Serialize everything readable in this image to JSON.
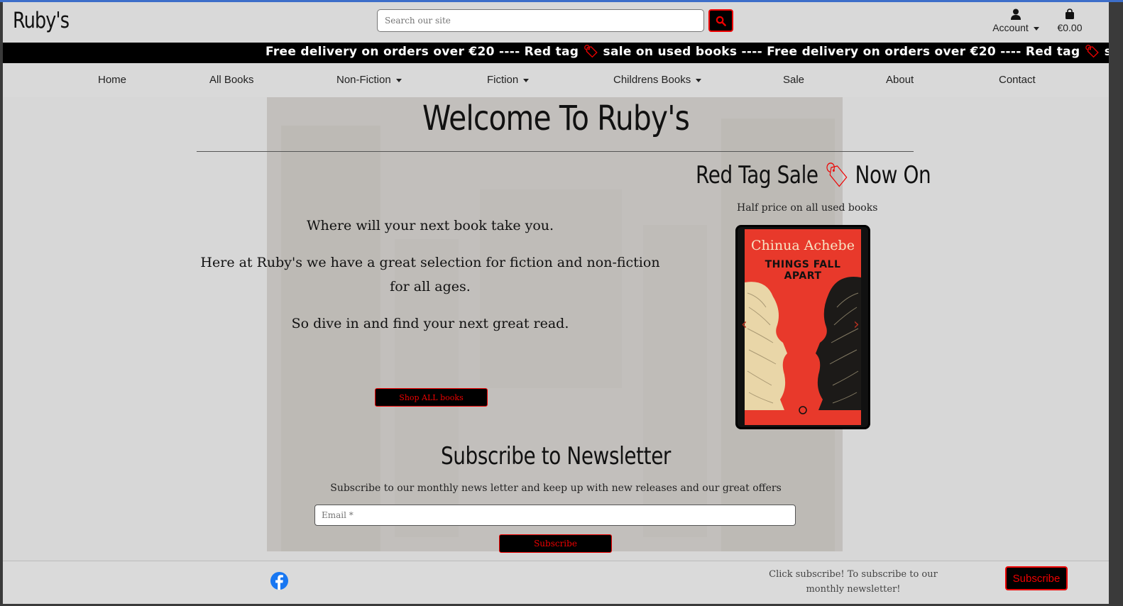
{
  "header": {
    "logo": "Ruby's",
    "search_placeholder": "Search our site",
    "account_label": "Account",
    "cart_total": "€0.00"
  },
  "ticker": {
    "segments": [
      "Free delivery on orders over €20 ---- Red tag ",
      " sale on used books ---- Free delivery on orders over €20 ---- Red tag ",
      " sale o"
    ]
  },
  "nav": {
    "items": [
      {
        "label": "Home",
        "dropdown": false
      },
      {
        "label": "All Books",
        "dropdown": false
      },
      {
        "label": "Non-Fiction",
        "dropdown": true
      },
      {
        "label": "Fiction",
        "dropdown": true
      },
      {
        "label": "Childrens Books",
        "dropdown": true
      },
      {
        "label": "Sale",
        "dropdown": false
      },
      {
        "label": "About",
        "dropdown": false
      },
      {
        "label": "Contact",
        "dropdown": false
      }
    ]
  },
  "hero": {
    "title": "Welcome To Ruby's",
    "line1": "Where will your next book take you.",
    "line2": "Here at Ruby's we have a great selection for fiction and non-fiction for all ages.",
    "line3": "So dive in and find your next great read.",
    "shop_button": "Shop ALL books"
  },
  "sale": {
    "title_before": "Red Tag Sale ",
    "title_after": " Now On",
    "subtitle": "Half price on all used books",
    "book_author": "Chinua Achebe",
    "book_title": "THINGS FALL APART"
  },
  "newsletter": {
    "title": "Subscribe to Newsletter",
    "subtitle": "Subscribe to our monthly news letter and keep up with new releases and our great offers",
    "email_placeholder": "Email *",
    "button": "Subscribe"
  },
  "footer": {
    "text": "Click subscribe! To subscribe to our monthly newsletter!",
    "button": "Subscribe"
  },
  "colors": {
    "accent_red": "#e00000",
    "facebook_blue": "#1877f2"
  }
}
